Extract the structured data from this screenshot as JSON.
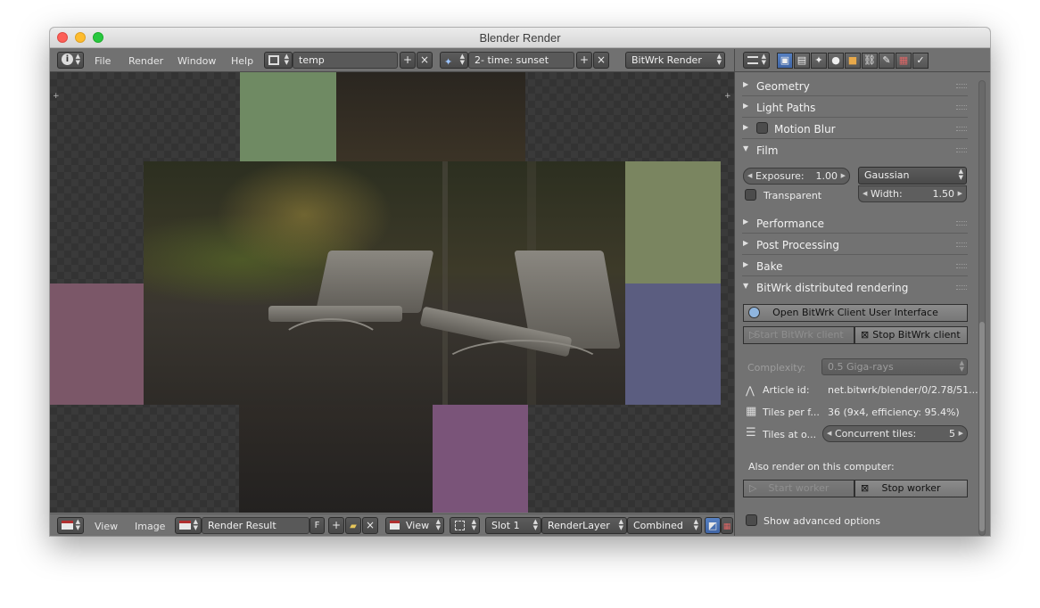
{
  "window": {
    "title": "Blender Render"
  },
  "top_header": {
    "menus": [
      "File",
      "Render",
      "Window",
      "Help"
    ],
    "screen_layout": "temp",
    "scene": "2- time: sunset",
    "render_engine": "BitWrk Render"
  },
  "bottom_header": {
    "menus": [
      "View",
      "Image"
    ],
    "image_name": "Render Result",
    "fake_user_label": "F",
    "view_label": "View",
    "slot": "Slot 1",
    "render_layer": "RenderLayer",
    "pass": "Combined"
  },
  "properties": {
    "sections": {
      "geometry": "Geometry",
      "light_paths": "Light Paths",
      "motion_blur": "Motion Blur",
      "film": "Film",
      "performance": "Performance",
      "post_processing": "Post Processing",
      "bake": "Bake",
      "bitwrk": "BitWrk distributed rendering"
    },
    "film": {
      "exposure_label": "Exposure:",
      "exposure_value": "1.00",
      "filter": "Gaussian",
      "transparent_label": "Transparent",
      "width_label": "Width:",
      "width_value": "1.50"
    },
    "bitwrk": {
      "open_ui_label": "Open BitWrk Client User Interface",
      "start_client_label": "Start BitWrk client",
      "stop_client_label": "Stop BitWrk client",
      "complexity_label": "Complexity:",
      "complexity_value": "0.5 Giga-rays",
      "article_id_label": "Article id:",
      "article_id_value": "net.bitwrk/blender/0/2.78/51...",
      "tiles_per_frame_label": "Tiles per f...",
      "tiles_per_frame_value": "36  (9x4, efficiency: 95.4%)",
      "tiles_at_once_label": "Tiles at o...",
      "concurrent_label": "Concurrent tiles:",
      "concurrent_value": "5",
      "also_render_label": "Also render on this computer:",
      "start_worker_label": "Start worker",
      "stop_worker_label": "Stop worker",
      "show_advanced_label": "Show advanced options"
    }
  },
  "colors": {
    "tile_green": "#6f8a63",
    "tile_olive": "#7a8560",
    "tile_slate": "#5b5d80",
    "tile_rose": "#7b5768",
    "tile_purple": "#7a5479",
    "accent_blue": "#4a73b5"
  }
}
